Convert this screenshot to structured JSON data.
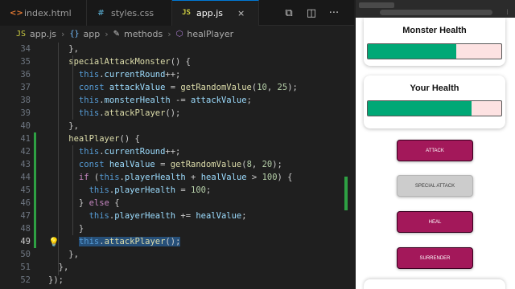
{
  "editor": {
    "tabs": [
      {
        "label": "index.html",
        "icon": "html-file-icon"
      },
      {
        "label": "styles.css",
        "icon": "css-file-icon"
      },
      {
        "label": "app.js",
        "icon": "js-file-icon",
        "active": true
      }
    ],
    "close_glyph": "×",
    "breadcrumb": [
      "app.js",
      "app",
      "methods",
      "healPlayer"
    ],
    "lines": [
      {
        "n": 34,
        "html": "<span class=\"p\">    },</span>"
      },
      {
        "n": 35,
        "html": "<span class=\"f\">    specialAttackMonster</span><span class=\"p\">() {</span>"
      },
      {
        "n": 36,
        "html": "<span class=\"k\">      this</span><span class=\"p\">.</span><span class=\"v\">currentRound</span><span class=\"p\">++;</span>"
      },
      {
        "n": 37,
        "html": "<span class=\"k\">      const </span><span class=\"v\">attackValue</span><span class=\"p\"> = </span><span class=\"f\">getRandomValue</span><span class=\"p\">(</span><span class=\"n\">10</span><span class=\"p\">, </span><span class=\"n\">25</span><span class=\"p\">);</span>"
      },
      {
        "n": 38,
        "html": "<span class=\"k\">      this</span><span class=\"p\">.</span><span class=\"v\">monsterHealth</span><span class=\"p\"> -= </span><span class=\"v\">attackValue</span><span class=\"p\">;</span>"
      },
      {
        "n": 39,
        "html": "<span class=\"k\">      this</span><span class=\"p\">.</span><span class=\"f\">attackPlayer</span><span class=\"p\">();</span>"
      },
      {
        "n": 40,
        "html": "<span class=\"p\">    },</span>"
      },
      {
        "n": 41,
        "html": "<span class=\"f\">    healPlayer</span><span class=\"p\">() {</span>",
        "changed": true
      },
      {
        "n": 42,
        "html": "<span class=\"k\">      this</span><span class=\"p\">.</span><span class=\"v\">currentRound</span><span class=\"p\">++;</span>",
        "changed": true
      },
      {
        "n": 43,
        "html": "<span class=\"k\">      const </span><span class=\"v\">healValue</span><span class=\"p\"> = </span><span class=\"f\">getRandomValue</span><span class=\"p\">(</span><span class=\"n\">8</span><span class=\"p\">, </span><span class=\"n\">20</span><span class=\"p\">);</span>",
        "changed": true
      },
      {
        "n": 44,
        "html": "<span class=\"kc\">      if </span><span class=\"p\">(</span><span class=\"k\">this</span><span class=\"p\">.</span><span class=\"v\">playerHealth</span><span class=\"p\"> + </span><span class=\"v\">healValue</span><span class=\"p\"> &gt; </span><span class=\"n\">100</span><span class=\"p\">) {</span>",
        "changed": true
      },
      {
        "n": 45,
        "html": "<span class=\"k\">        this</span><span class=\"p\">.</span><span class=\"v\">playerHealth</span><span class=\"p\"> = </span><span class=\"n\">100</span><span class=\"p\">;</span>",
        "changed": true
      },
      {
        "n": 46,
        "html": "<span class=\"p\">      } </span><span class=\"kc\">else</span><span class=\"p\"> {</span>",
        "changed": true
      },
      {
        "n": 47,
        "html": "<span class=\"k\">        this</span><span class=\"p\">.</span><span class=\"v\">playerHealth</span><span class=\"p\"> += </span><span class=\"v\">healValue</span><span class=\"p\">;</span>",
        "changed": true
      },
      {
        "n": 48,
        "html": "<span class=\"p\">      }</span>",
        "changed": true
      },
      {
        "n": 49,
        "html": "<span class=\"p\">      </span><span class=\"sel\"><span class=\"k\">this</span><span class=\"p\">.</span><span class=\"f\">attackPlayer</span><span class=\"p\">();</span></span>",
        "changed": true,
        "current": true,
        "bulb": true
      },
      {
        "n": 50,
        "html": "<span class=\"p\">    },</span>"
      },
      {
        "n": 51,
        "html": "<span class=\"p\">  },</span>"
      },
      {
        "n": 52,
        "html": "<span class=\"p\">});</span>"
      }
    ]
  },
  "browser": {
    "monster_health": {
      "title": "Monster Health",
      "value": 66
    },
    "your_health": {
      "title": "Your Health",
      "value": 78
    },
    "buttons": [
      {
        "label": "ATTACK",
        "style": "primary"
      },
      {
        "label": "SPECIAL ATTACK",
        "style": "disabled"
      },
      {
        "label": "HEAL",
        "style": "primary"
      },
      {
        "label": "SURRENDER",
        "style": "primary"
      }
    ],
    "colors": {
      "accent": "#a3185a",
      "health_fill": "#00a876",
      "health_track": "#fde2e2"
    }
  }
}
